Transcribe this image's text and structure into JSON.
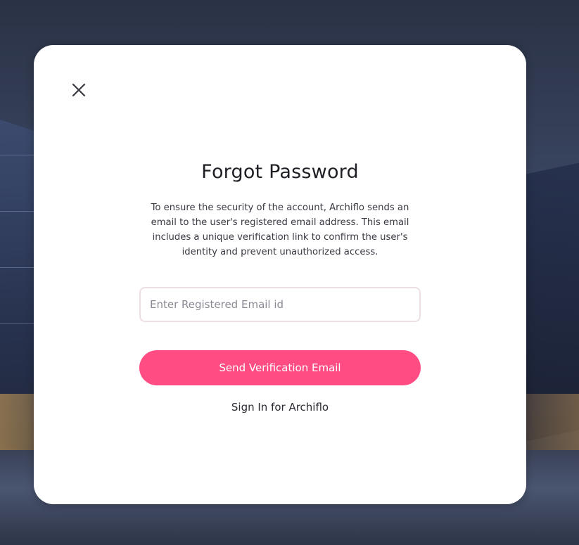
{
  "background": {
    "description_icon": "architecture-night-photo"
  },
  "modal": {
    "close_icon": "close-icon",
    "title": "Forgot Password",
    "description": "To ensure the security of the account, Archiflo sends an email to the user's registered email address. This email includes a unique verification link to confirm the user's identity and prevent unauthorized access.",
    "email_input": {
      "value": "",
      "placeholder": "Enter Registered Email id"
    },
    "send_button_label": "Send Verification Email",
    "signin_link_label": "Sign In for Archiflo"
  },
  "colors": {
    "accent": "#ff4d84",
    "input_border": "#ece0e6",
    "title_text": "#1e1e24"
  }
}
